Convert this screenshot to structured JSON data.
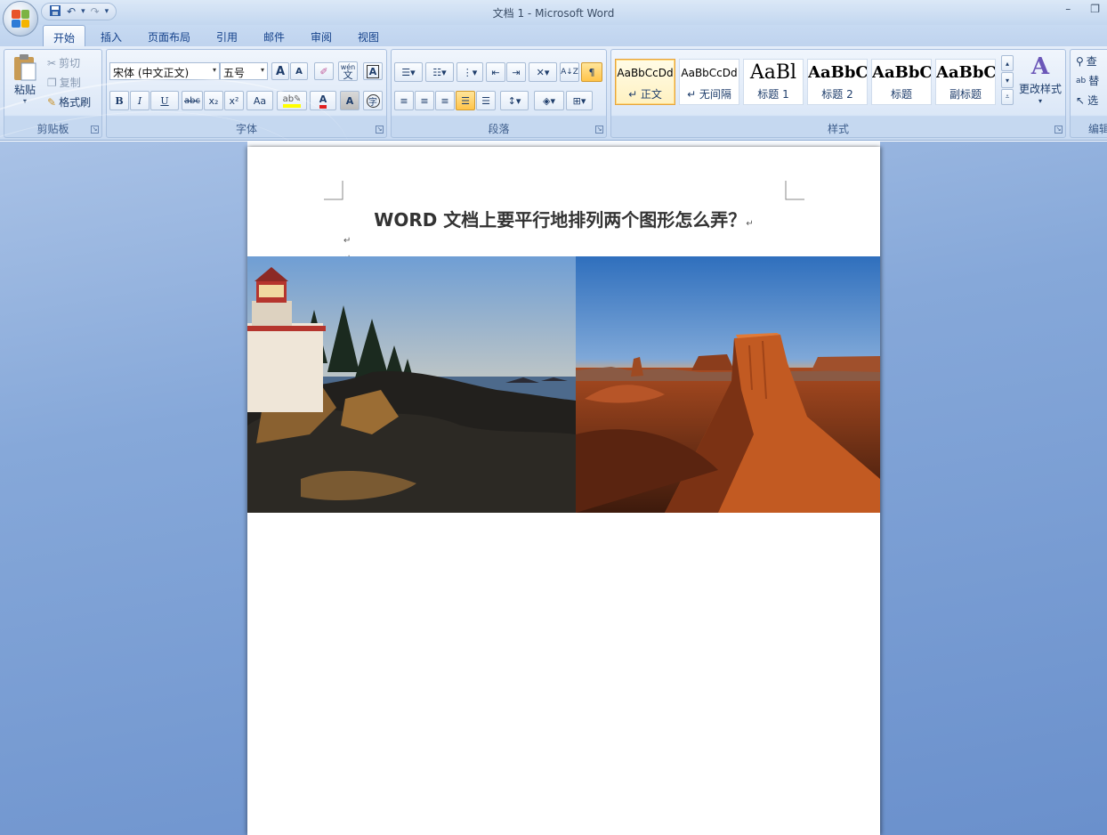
{
  "window": {
    "title": "文档 1 - Microsoft Word",
    "minimize": "–",
    "restore": "❐"
  },
  "qat": {
    "save_icon": "save-icon",
    "undo": "↶",
    "undo_drop": "▾",
    "redo": "↷",
    "customize": "▾"
  },
  "tabs": [
    "开始",
    "插入",
    "页面布局",
    "引用",
    "邮件",
    "审阅",
    "视图"
  ],
  "clipboard": {
    "paste": "粘贴",
    "cut": "剪切",
    "copy": "复制",
    "format_painter": "格式刷",
    "label": "剪贴板"
  },
  "font": {
    "name": "宋体 (中文正文)",
    "size": "五号",
    "grow": "A",
    "shrink": "A",
    "bold": "B",
    "italic": "I",
    "underline": "U",
    "strike": "abc",
    "sub": "x₂",
    "sup": "x²",
    "case": "Aa",
    "label": "字体",
    "phonetic": "wén",
    "phonetic_char": "文"
  },
  "paragraph": {
    "label": "段落"
  },
  "styles": {
    "label": "样式",
    "items": [
      {
        "sample": "AaBbCcDd",
        "name": "↵ 正文",
        "selected": true
      },
      {
        "sample": "AaBbCcDd",
        "name": "↵ 无间隔",
        "selected": false
      },
      {
        "sample": "AaBl",
        "name": "标题 1",
        "selected": false
      },
      {
        "sample": "AaBbC",
        "name": "标题 2",
        "selected": false
      },
      {
        "sample": "AaBbC",
        "name": "标题",
        "selected": false
      },
      {
        "sample": "AaBbC",
        "name": "副标题",
        "selected": false
      }
    ],
    "change": "更改样式"
  },
  "editing": {
    "find": "查",
    "replace": "替",
    "select": "选",
    "label": "编辑"
  },
  "document": {
    "heading": "WORD 文档上要平行地排列两个图形怎么弄？",
    "para_mark": "↵"
  },
  "images": [
    {
      "name": "lighthouse-photo",
      "desc": "lighthouse on rocky coast at sunset"
    },
    {
      "name": "desert-butte-photo",
      "desc": "red desert mesa"
    }
  ],
  "colors": {
    "accent": "#15428b",
    "ribbon": "#d6e3f5",
    "workspace": "#86a8d9"
  }
}
